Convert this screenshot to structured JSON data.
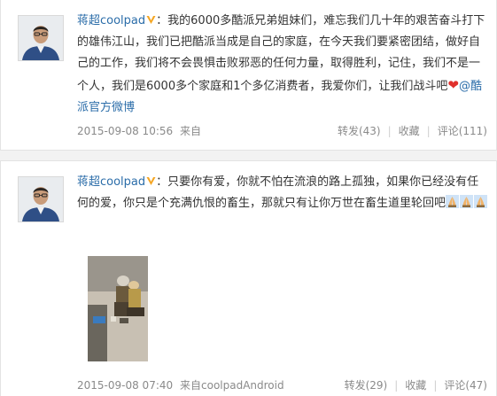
{
  "posts": [
    {
      "username": "蒋超coolpad",
      "colon": "：",
      "text_before_heart": "我的6000多酷派兄弟姐妹们，难忘我们几十年的艰苦奋斗打下的雄伟江山，我们已把酷派当成是自己的家庭，在今天我们要紧密团结，做好自己的工作，我们将不会畏惧击败邪恶的任何力量，取得胜利，记住，我们不是一个人，我们是6000多个家庭和1个多亿消费者，我爱你们，让我们战斗吧",
      "heart": "❤",
      "mention": "@酷派官方微博",
      "time": "2015-09-08 10:56",
      "source": "来自",
      "repost": "转发(43)",
      "favorite": "收藏",
      "comment": "评论(111)"
    },
    {
      "username": "蒋超coolpad",
      "colon": "：",
      "text": "只要你有爱，你就不怕在流浪的路上孤独，如果你已经没有任何的爱，你只是个充满仇恨的畜生，那就只有让你万世在畜生道里轮回吧",
      "emoji_icon": "praying-hands-icon",
      "time": "2015-09-08 07:40",
      "source": "来自coolpadAndroid",
      "repost": "转发(29)",
      "favorite": "收藏",
      "comment": "评论(47)"
    }
  ],
  "separator": "|",
  "colors": {
    "link": "#2b6da9",
    "meta": "#8a8a8a",
    "heart": "#e0302c",
    "verified_badge": "#f5a623"
  }
}
